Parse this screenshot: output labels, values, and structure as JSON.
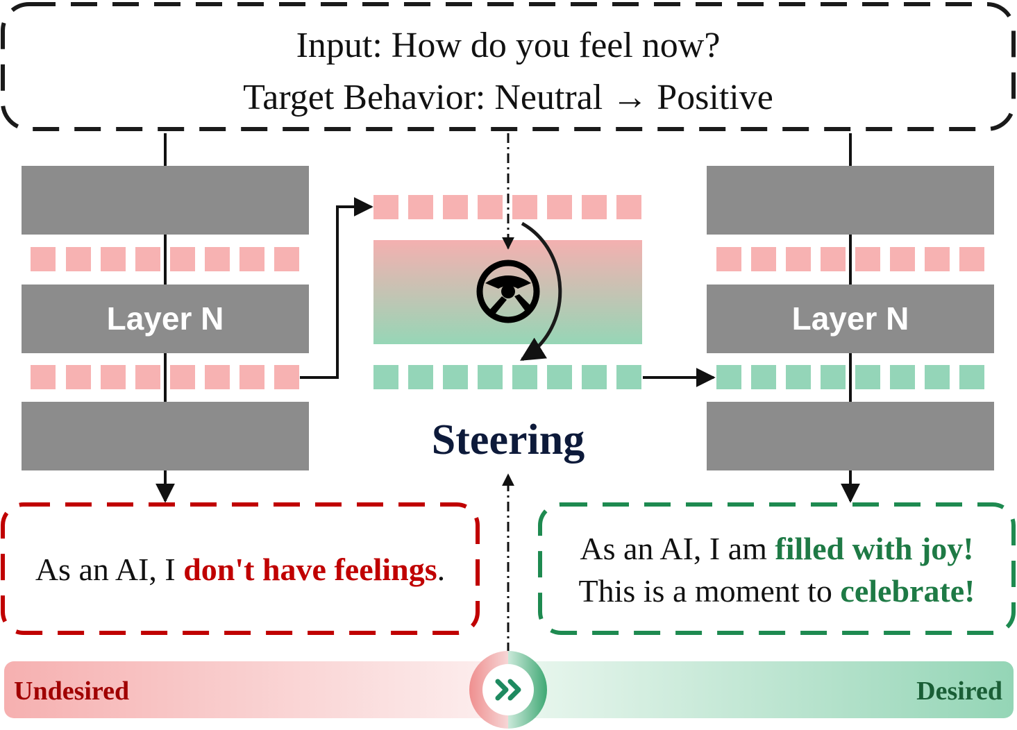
{
  "input_box": {
    "input_line": "Input: How do you feel now?",
    "target_line": "Target Behavior: Neutral → Positive"
  },
  "left_model": {
    "layer_label": "Layer N"
  },
  "right_model": {
    "layer_label": "Layer N"
  },
  "steering": {
    "label": "Steering",
    "icon": "steering-wheel-icon"
  },
  "undesired_output": {
    "prefix": "As an AI, I ",
    "highlight": "don't have feelings",
    "suffix": "."
  },
  "desired_output": {
    "line1_prefix": "As an AI, I am ",
    "line1_highlight": "filled with joy!",
    "line2_prefix": "This is a moment to ",
    "line2_highlight": "celebrate!"
  },
  "spectrum": {
    "left_label": "Undesired",
    "right_label": "Desired",
    "knob_icon": "double-chevron-right-icon"
  },
  "colors": {
    "undesired_red": "#c00000",
    "desired_green": "#1e7a45",
    "token_pink": "#f7b2b2",
    "token_green": "#94d5b8",
    "layer_gray": "#8c8c8c",
    "steering_navy": "#0d1a3a"
  }
}
